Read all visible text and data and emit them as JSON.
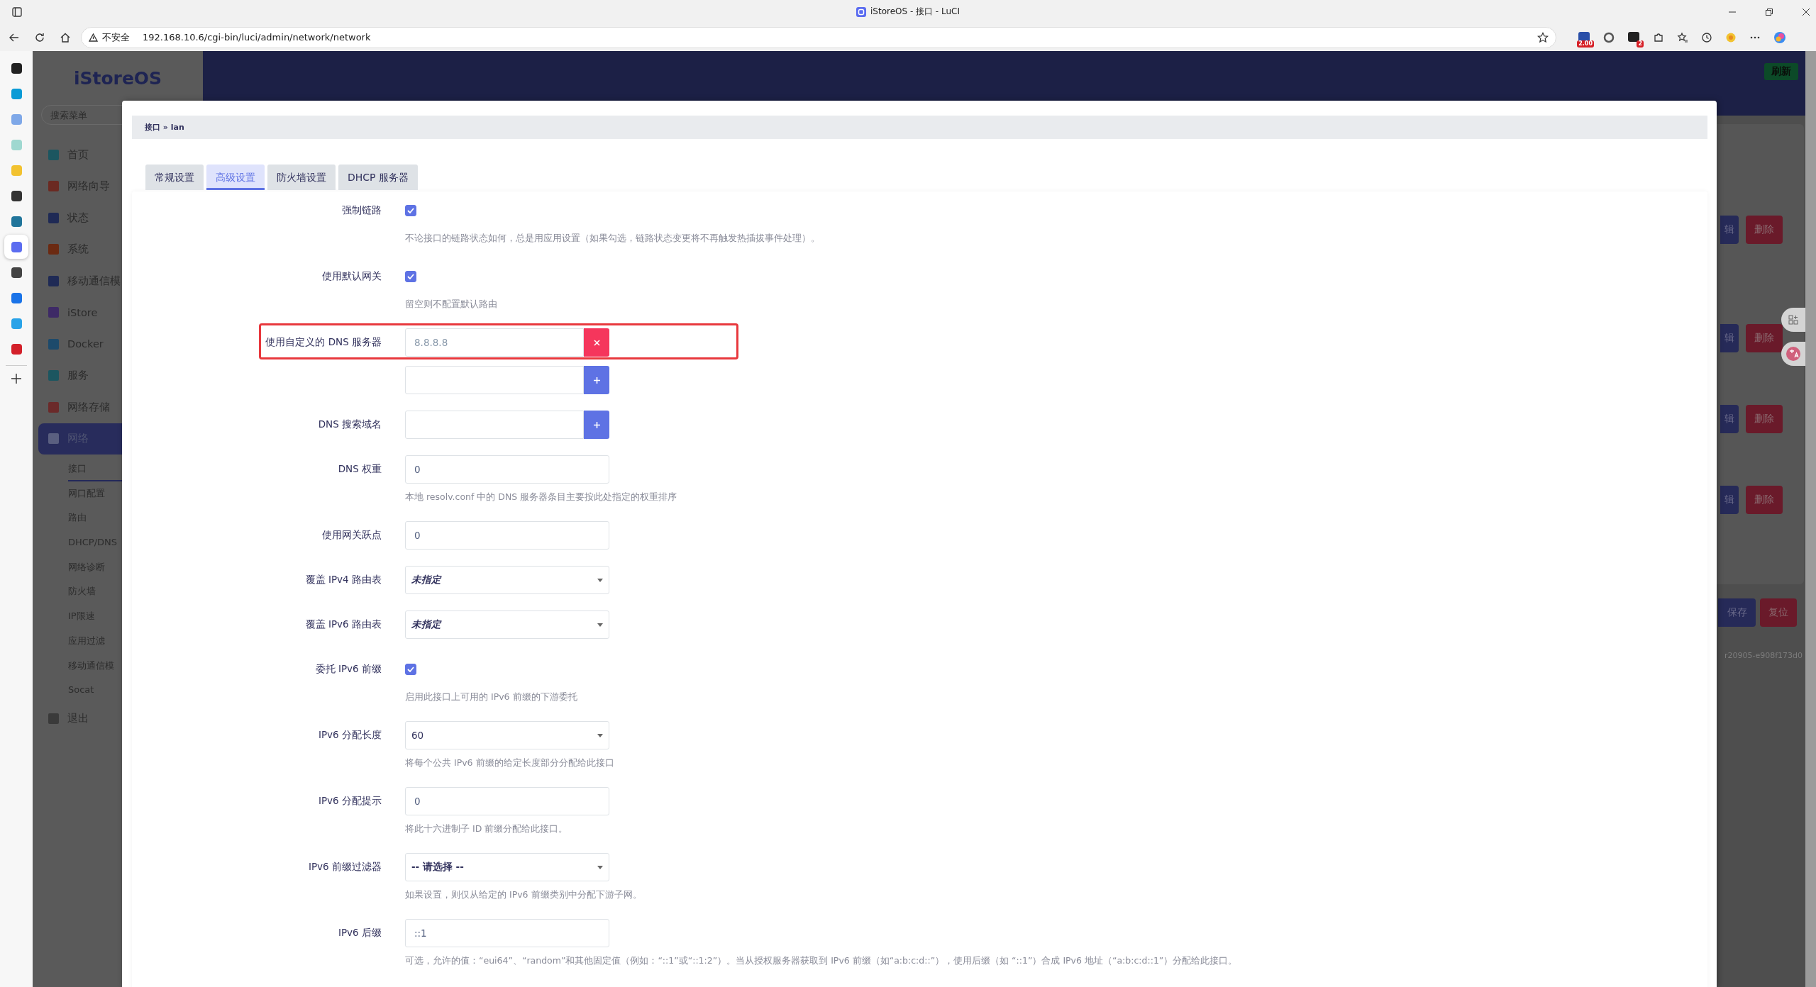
{
  "browser": {
    "title": "iStoreOS - 接口 - LuCI",
    "security": "不安全",
    "url": "192.168.10.6/cgi-bin/luci/admin/network/network",
    "badges": [
      "2.00",
      "2"
    ]
  },
  "side_panel": [
    {
      "color": "#222222",
      "selected": false
    },
    {
      "color": "#0a9bd6",
      "selected": false
    },
    {
      "color": "#7fa8e8",
      "selected": false
    },
    {
      "color": "#9fd8d0",
      "selected": false
    },
    {
      "color": "#f2c230",
      "selected": false
    },
    {
      "color": "#333333",
      "selected": false
    },
    {
      "color": "#21759b",
      "selected": false
    },
    {
      "color": "#5b6cf0",
      "selected": true
    },
    {
      "color": "#444444",
      "selected": false
    },
    {
      "color": "#1a73e8",
      "selected": false
    },
    {
      "color": "#2aa3e8",
      "selected": false
    },
    {
      "color": "#d3202a",
      "selected": false
    }
  ],
  "sidebar": {
    "logo": "iStoreOS",
    "search_placeholder": "搜索菜单",
    "items": [
      {
        "label": "首页",
        "color": "#1c5660",
        "selected": false
      },
      {
        "label": "网络向导",
        "color": "#6b2a22",
        "selected": false
      },
      {
        "label": "状态",
        "color": "#1f2a55",
        "selected": false
      },
      {
        "label": "系统",
        "color": "#6b2a12",
        "selected": false
      },
      {
        "label": "移动通信模",
        "color": "#1f2a55",
        "selected": false
      },
      {
        "label": "iStore",
        "color": "#3e2a66",
        "selected": false
      },
      {
        "label": "Docker",
        "color": "#1d4a6b",
        "selected": false
      },
      {
        "label": "服务",
        "color": "#1c5660",
        "selected": false
      },
      {
        "label": "网络存储",
        "color": "#6b2a2a",
        "selected": false
      },
      {
        "label": "网络",
        "color": "#5a5f80",
        "selected": true,
        "children": [
          {
            "label": "接口",
            "selected": true
          },
          {
            "label": "网口配置",
            "selected": false
          },
          {
            "label": "路由",
            "selected": false
          },
          {
            "label": "DHCP/DNS",
            "selected": false
          },
          {
            "label": "网络诊断",
            "selected": false
          },
          {
            "label": "防火墙",
            "selected": false
          },
          {
            "label": "IP限速",
            "selected": false
          },
          {
            "label": "应用过滤",
            "selected": false
          },
          {
            "label": "移动通信模",
            "selected": false
          },
          {
            "label": "Socat",
            "selected": false
          }
        ]
      },
      {
        "label": "退出",
        "color": "#3a3a3a",
        "selected": false
      }
    ]
  },
  "header": {
    "refresh_button": "刷新"
  },
  "background": {
    "rows": [
      {
        "edit": "辑",
        "delete": "删除"
      },
      {
        "edit": "辑",
        "delete": "删除"
      },
      {
        "edit": "辑",
        "delete": "删除"
      },
      {
        "edit": "辑",
        "delete": "删除"
      }
    ],
    "save": "保存",
    "reset": "复位",
    "version": "r20905-e908f173d0"
  },
  "dialog": {
    "breadcrumb": "接口 » lan",
    "tabs": [
      {
        "label": "常规设置",
        "selected": false
      },
      {
        "label": "高级设置",
        "selected": true
      },
      {
        "label": "防火墙设置",
        "selected": false
      },
      {
        "label": "DHCP 服务器",
        "selected": false
      }
    ],
    "fields": [
      {
        "kind": "checkbox",
        "label": "强制链路",
        "checked": true,
        "highlighted": false,
        "description": "不论接口的链路状态如何，总是用应用设置（如果勾选，链路状态变更将不再触发热插拔事件处理）。"
      },
      {
        "kind": "checkbox",
        "label": "使用默认网关",
        "checked": true,
        "highlighted": false,
        "description": "留空则不配置默认路由"
      },
      {
        "kind": "dynlist",
        "label": "使用自定义的 DNS 服务器",
        "highlighted": true,
        "items": [
          {
            "value": "8.8.8.8",
            "kind": "remove"
          },
          {
            "kind": "add"
          }
        ]
      },
      {
        "kind": "dynlist",
        "label": "DNS 搜索域名",
        "highlighted": false,
        "items": [
          {
            "kind": "add"
          }
        ]
      },
      {
        "kind": "text",
        "label": "DNS 权重",
        "value": "0",
        "highlighted": false,
        "description": "本地 resolv.conf 中的 DNS 服务器条目主要按此处指定的权重排序"
      },
      {
        "kind": "text",
        "label": "使用网关跃点",
        "value": "0",
        "highlighted": false
      },
      {
        "kind": "select",
        "label": "覆盖 IPv4 路由表",
        "value": "未指定",
        "italic": true,
        "bold": true,
        "highlighted": false
      },
      {
        "kind": "select",
        "label": "覆盖 IPv6 路由表",
        "value": "未指定",
        "italic": true,
        "bold": true,
        "highlighted": false
      },
      {
        "kind": "checkbox",
        "label": "委托 IPv6 前缀",
        "checked": true,
        "highlighted": false,
        "description": "启用此接口上可用的 IPv6 前缀的下游委托"
      },
      {
        "kind": "select",
        "label": "IPv6 分配长度",
        "value": "60",
        "italic": false,
        "bold": false,
        "highlighted": false,
        "description": "将每个公共 IPv6 前缀的给定长度部分分配给此接口"
      },
      {
        "kind": "text",
        "label": "IPv6 分配提示",
        "value": "0",
        "highlighted": false,
        "description": "将此十六进制子 ID 前缀分配给此接口。"
      },
      {
        "kind": "select",
        "label": "IPv6 前缀过滤器",
        "value": "-- 请选择 --",
        "italic": false,
        "bold": true,
        "highlighted": false,
        "description": "如果设置，则仅从给定的 IPv6 前缀类别中分配下游子网。"
      },
      {
        "kind": "text",
        "label": "IPv6 后缀",
        "value": "::1",
        "highlighted": false,
        "description": "可选，允许的值：“eui64”、“random”和其他固定值（例如：“::1”或“::1:2”）。当从授权服务器获取到 IPv6 前缀（如“a:b:c:d::”），使用后缀（如 “::1”）合成 IPv6 地址（“a:b:c:d::1”）分配给此接口。"
      }
    ]
  }
}
